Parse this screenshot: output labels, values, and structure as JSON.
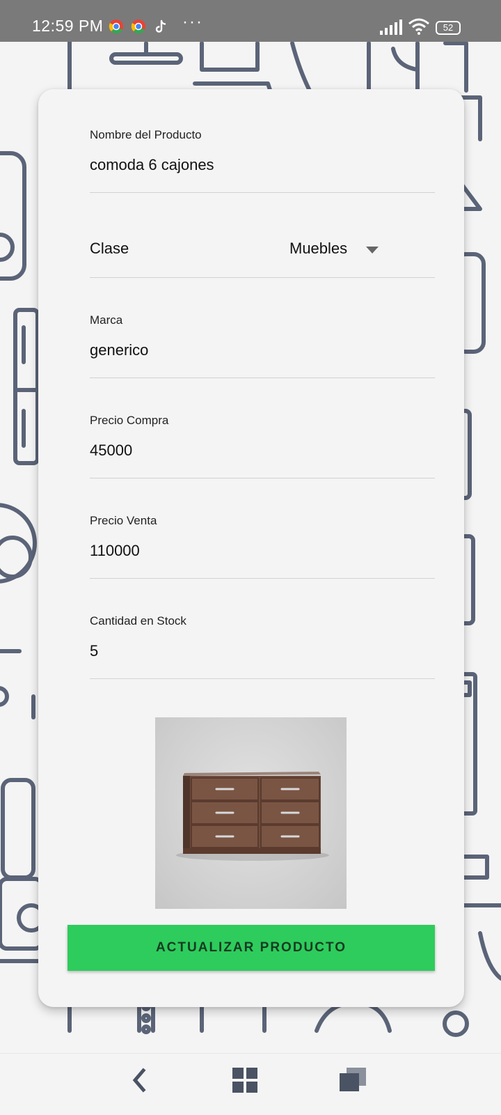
{
  "status_bar": {
    "time": "12:59 PM",
    "icons": [
      "chrome-icon",
      "chrome-icon",
      "tiktok-icon",
      "more-dots-icon",
      "signal-icon",
      "wifi-icon",
      "battery-icon"
    ],
    "more": "···",
    "battery_level": "52"
  },
  "form": {
    "product_name": {
      "label": "Nombre del Producto",
      "value": "comoda 6 cajones"
    },
    "class": {
      "label": "Clase",
      "selected": "Muebles"
    },
    "brand": {
      "label": "Marca",
      "value": "generico"
    },
    "purchase_price": {
      "label": "Precio Compra",
      "value": "45000"
    },
    "sale_price": {
      "label": "Precio Venta",
      "value": "110000"
    },
    "stock": {
      "label": "Cantidad en Stock",
      "value": "5"
    }
  },
  "product_image": {
    "icon": "dresser-image"
  },
  "actions": {
    "update_label": "ACTUALIZAR PRODUCTO"
  },
  "nav_bar": {
    "icons": [
      "back-icon",
      "home-icon",
      "recents-icon"
    ]
  },
  "colors": {
    "status_bar": "#7a7a7a",
    "button": "#2ecc5c",
    "background": "#f4f4f4",
    "doodle": "#5b6478"
  }
}
